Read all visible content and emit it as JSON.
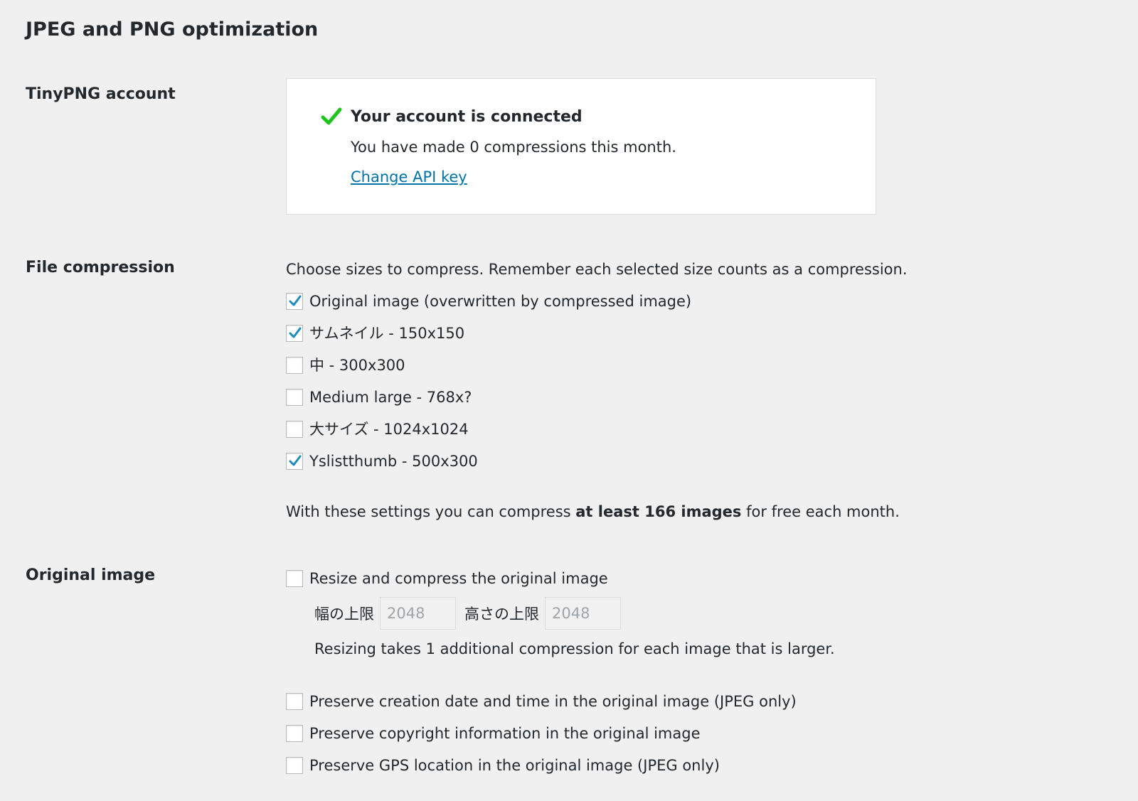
{
  "page_title": "JPEG and PNG optimization",
  "account": {
    "label": "TinyPNG account",
    "status": "Your account is connected",
    "usage": "You have made 0 compressions this month.",
    "change_key_link": "Change API key",
    "check_color": "#1ec31e"
  },
  "compression": {
    "label": "File compression",
    "intro": "Choose sizes to compress. Remember each selected size counts as a compression.",
    "sizes": [
      {
        "label": "Original image (overwritten by compressed image)",
        "checked": true
      },
      {
        "label": "サムネイル - 150x150",
        "checked": true
      },
      {
        "label": "中 - 300x300",
        "checked": false
      },
      {
        "label": "Medium large - 768x?",
        "checked": false
      },
      {
        "label": "大サイズ - 1024x1024",
        "checked": false
      },
      {
        "label": "Yslistthumb - 500x300",
        "checked": true
      }
    ],
    "summary_prefix": "With these settings you can compress ",
    "summary_bold": "at least 166 images",
    "summary_suffix": " for free each month."
  },
  "original_image": {
    "label": "Original image",
    "resize_option": {
      "label": "Resize and compress the original image",
      "checked": false
    },
    "max_width_label": "幅の上限",
    "max_width_value": "2048",
    "max_height_label": "高さの上限",
    "max_height_value": "2048",
    "resize_note": "Resizing takes 1 additional compression for each image that is larger.",
    "preserve_options": [
      {
        "label": "Preserve creation date and time in the original image (JPEG only)",
        "checked": false
      },
      {
        "label": "Preserve copyright information in the original image",
        "checked": false
      },
      {
        "label": "Preserve GPS location in the original image (JPEG only)",
        "checked": false
      }
    ]
  },
  "colors": {
    "link": "#0073aa",
    "checkbox_tick": "#1e8cbe",
    "background": "#f0f0f0"
  }
}
